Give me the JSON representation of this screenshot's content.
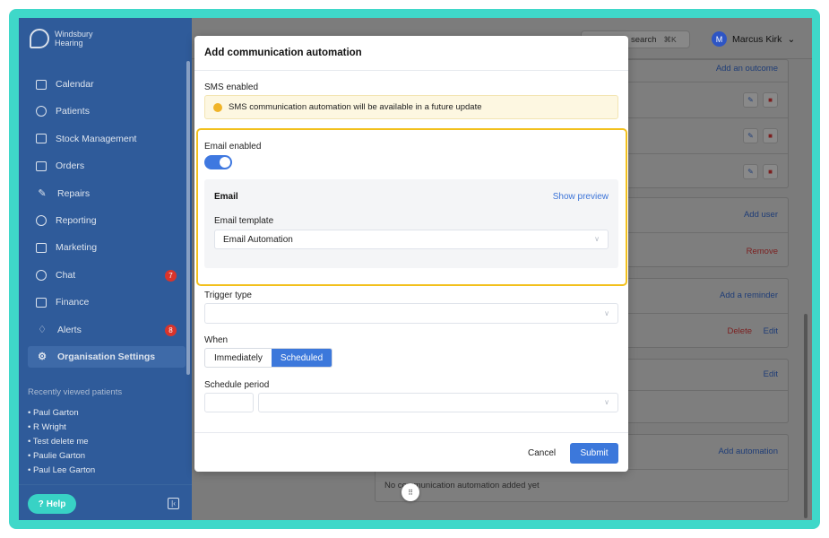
{
  "brand": {
    "line1": "Windsbury",
    "line2": "Hearing"
  },
  "sidebar": {
    "items": [
      {
        "label": "Calendar",
        "icon": "calendar-icon"
      },
      {
        "label": "Patients",
        "icon": "smile-icon"
      },
      {
        "label": "Stock Management",
        "icon": "clipboard-icon"
      },
      {
        "label": "Orders",
        "icon": "box-icon"
      },
      {
        "label": "Repairs",
        "icon": "wrench-icon"
      },
      {
        "label": "Reporting",
        "icon": "pie-chart-icon"
      },
      {
        "label": "Marketing",
        "icon": "mail-icon"
      },
      {
        "label": "Chat",
        "icon": "chat-icon",
        "badge": "7"
      },
      {
        "label": "Finance",
        "icon": "card-icon"
      },
      {
        "label": "Alerts",
        "icon": "bell-icon",
        "badge": "8"
      },
      {
        "label": "Organisation Settings",
        "icon": "gear-icon",
        "active": true
      }
    ],
    "recent_title": "Recently viewed patients",
    "recent": [
      "• Paul Garton",
      "• R Wright",
      "• Test delete me",
      "• Paulie Garton",
      "• Paul Lee Garton"
    ],
    "help_label": "Help"
  },
  "topbar": {
    "search_label": "search",
    "shortcut": "⌘K",
    "user_name": "Marcus Kirk",
    "user_initial": "M"
  },
  "background": {
    "add_outcome": "Add an outcome",
    "add_user": "Add user",
    "remove": "Remove",
    "add_reminder": "Add a reminder",
    "delete": "Delete",
    "edit": "Edit",
    "edit2": "Edit",
    "add_automation": "Add automation",
    "no_automation": "No communication automation added yet"
  },
  "modal": {
    "title": "Add communication automation",
    "sms_label": "SMS enabled",
    "sms_notice": "SMS communication automation will be available in a future update",
    "email_label": "Email enabled",
    "email_enabled": true,
    "email_panel_title": "Email",
    "show_preview": "Show preview",
    "email_template_label": "Email template",
    "email_template_value": "Email Automation",
    "trigger_label": "Trigger type",
    "trigger_value": "",
    "when_label": "When",
    "when_options": [
      "Immediately",
      "Scheduled"
    ],
    "when_selected": "Scheduled",
    "schedule_label": "Schedule period",
    "cancel": "Cancel",
    "submit": "Submit"
  },
  "colors": {
    "sidebar": "#2f5b9a",
    "accent": "#3c78db",
    "highlight": "#f2c01c",
    "frame": "#3fd8c9",
    "badge": "#d9342b"
  }
}
